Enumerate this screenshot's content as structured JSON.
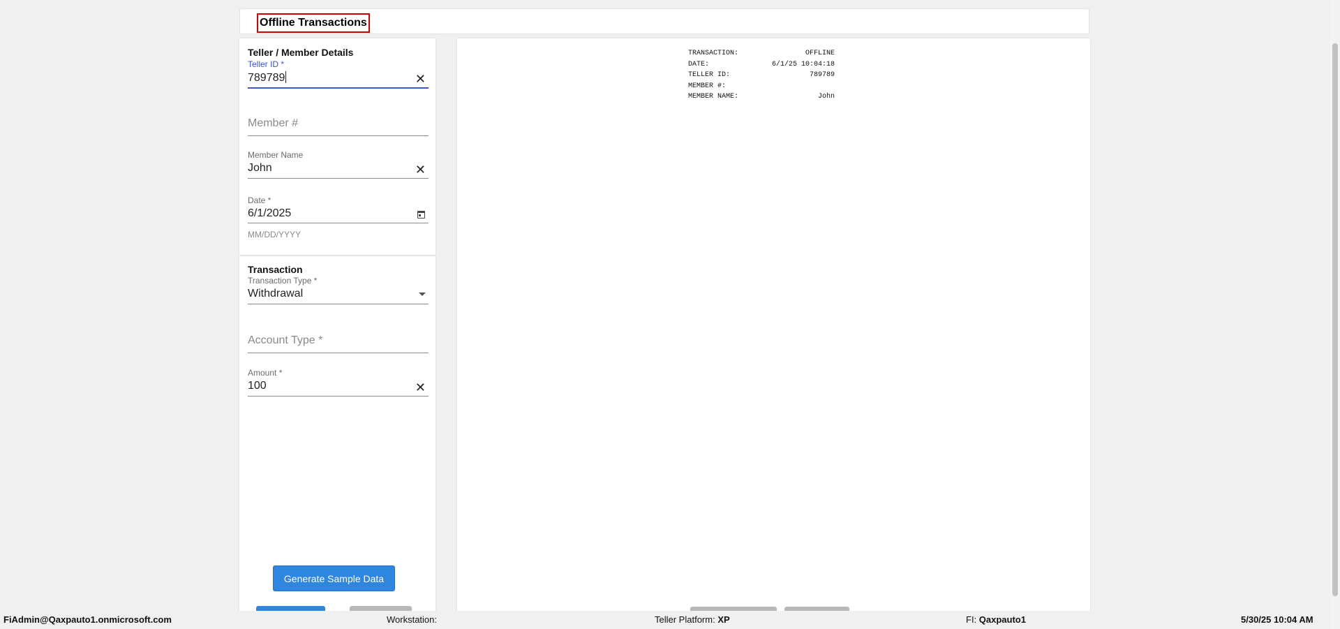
{
  "header": {
    "title": "Offline Transactions"
  },
  "teller_member": {
    "section_title": "Teller / Member Details",
    "teller_id": {
      "label": "Teller ID *",
      "value": "789789"
    },
    "member_number": {
      "placeholder": "Member #"
    },
    "member_name": {
      "label": "Member Name",
      "value": "John"
    },
    "date": {
      "label": "Date *",
      "value": "6/1/2025",
      "helper": "MM/DD/YYYY"
    }
  },
  "transaction": {
    "section_title": "Transaction",
    "type": {
      "label": "Transaction Type *",
      "value": "Withdrawal"
    },
    "account_type": {
      "placeholder": "Account Type *"
    },
    "amount": {
      "label": "Amount *",
      "value": "100"
    }
  },
  "buttons": {
    "generate_sample_data": "Generate Sample Data"
  },
  "receipt": {
    "rows": [
      {
        "label": "TRANSACTION:",
        "value": "OFFLINE"
      },
      {
        "label": "DATE:",
        "value": "6/1/25 10:04:18"
      },
      {
        "label": "TELLER ID:",
        "value": "789789"
      },
      {
        "label": "MEMBER #:",
        "value": ""
      },
      {
        "label": "MEMBER NAME:",
        "value": "John"
      }
    ]
  },
  "footer": {
    "user": "FiAdmin@Qaxpauto1.onmicrosoft.com",
    "workstation_label": "Workstation:",
    "workstation_value": "",
    "platform_label": "Teller Platform:",
    "platform_value": "XP",
    "fi_label": "FI:",
    "fi_value": "Qaxpauto1",
    "datetime": "5/30/25 10:04 AM"
  },
  "colors": {
    "accent": "#3a56c8",
    "primary_button": "#2e86de",
    "title_outline": "#d40000",
    "background": "#f0f0f0"
  },
  "icons": [
    "close-icon",
    "calendar-icon",
    "dropdown-arrow-icon"
  ]
}
